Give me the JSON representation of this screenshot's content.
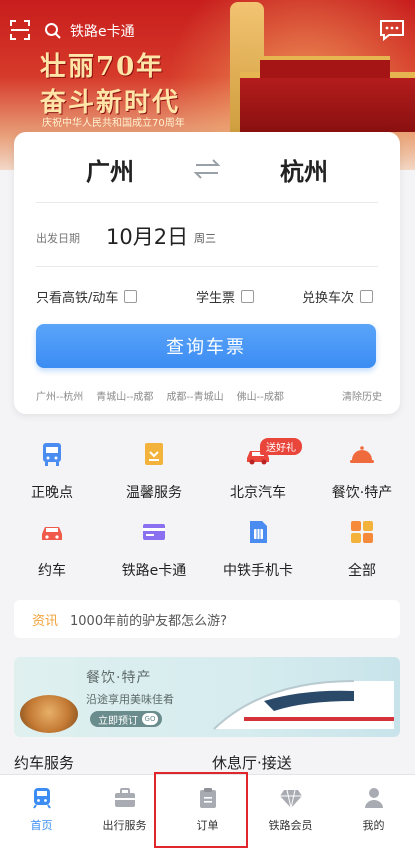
{
  "header": {
    "search_placeholder": "铁路e卡通",
    "banner_line1": "壮丽70年",
    "banner_line2": "奋斗新时代",
    "banner_sub": "庆祝中华人民共和国成立70周年"
  },
  "booking": {
    "from_city": "广州",
    "to_city": "杭州",
    "date_label": "出发日期",
    "date_value": "10月2日",
    "weekday": "周三",
    "options": [
      {
        "label": "只看高铁/动车",
        "checked": false
      },
      {
        "label": "学生票",
        "checked": false
      },
      {
        "label": "兑换车次",
        "checked": false
      }
    ],
    "query_label": "查询车票",
    "history": [
      "广州--杭州",
      "青城山--成都",
      "成都--青城山",
      "佛山--成都"
    ],
    "clear_label": "清除历史"
  },
  "services": [
    {
      "label": "正晚点",
      "icon": "bus-icon"
    },
    {
      "label": "温馨服务",
      "icon": "gift-box-icon"
    },
    {
      "label": "北京汽车",
      "icon": "car-icon",
      "badge": "送好礼"
    },
    {
      "label": "餐饮·特产",
      "icon": "food-cover-icon"
    },
    {
      "label": "约车",
      "icon": "taxi-icon"
    },
    {
      "label": "铁路e卡通",
      "icon": "card-icon"
    },
    {
      "label": "中铁手机卡",
      "icon": "sim-card-icon"
    },
    {
      "label": "全部",
      "icon": "grid-icon"
    }
  ],
  "news": {
    "tag": "资讯",
    "text": "1000年前的驴友都怎么游?"
  },
  "promo": {
    "title": "餐饮·特产",
    "subtitle": "沿途享用美味佳肴",
    "button": "立即预订",
    "go": "GO"
  },
  "sections": {
    "left": "约车服务",
    "right": "休息厅·接送"
  },
  "tabs": [
    {
      "label": "首页",
      "active": true
    },
    {
      "label": "出行服务",
      "active": false
    },
    {
      "label": "订单",
      "active": false
    },
    {
      "label": "铁路会员",
      "active": false
    },
    {
      "label": "我的",
      "active": false
    }
  ],
  "colors": {
    "accent": "#3b8cf3",
    "service_icon": "#4a8cf0",
    "service_red": "#e9453a",
    "highlight": "#e0262b"
  }
}
